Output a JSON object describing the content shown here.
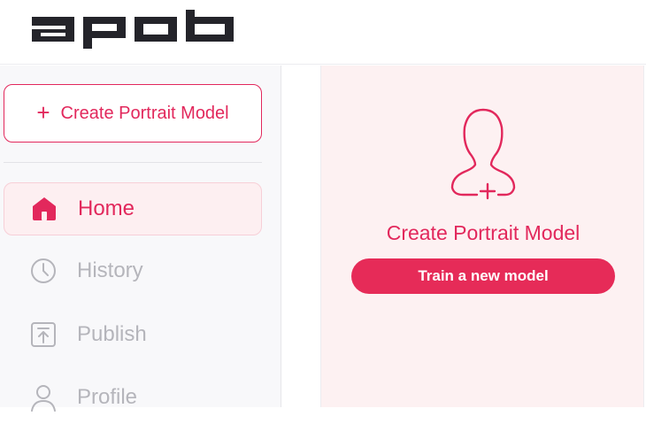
{
  "app": {
    "logo_text": "apob"
  },
  "colors": {
    "accent": "#e2285c",
    "accent_bg": "#fdf1f2",
    "inactive": "#b5b5bb"
  },
  "sidebar": {
    "create_button": {
      "label": "Create Portrait Model",
      "icon": "plus-icon"
    },
    "items": [
      {
        "label": "Home",
        "icon": "home-icon",
        "active": true
      },
      {
        "label": "History",
        "icon": "clock-icon",
        "active": false
      },
      {
        "label": "Publish",
        "icon": "upload-icon",
        "active": false
      },
      {
        "label": "Profile",
        "icon": "user-icon",
        "active": false
      }
    ]
  },
  "main": {
    "card": {
      "icon": "add-user-icon",
      "title": "Create Portrait Model",
      "button_label": "Train a new model"
    }
  }
}
